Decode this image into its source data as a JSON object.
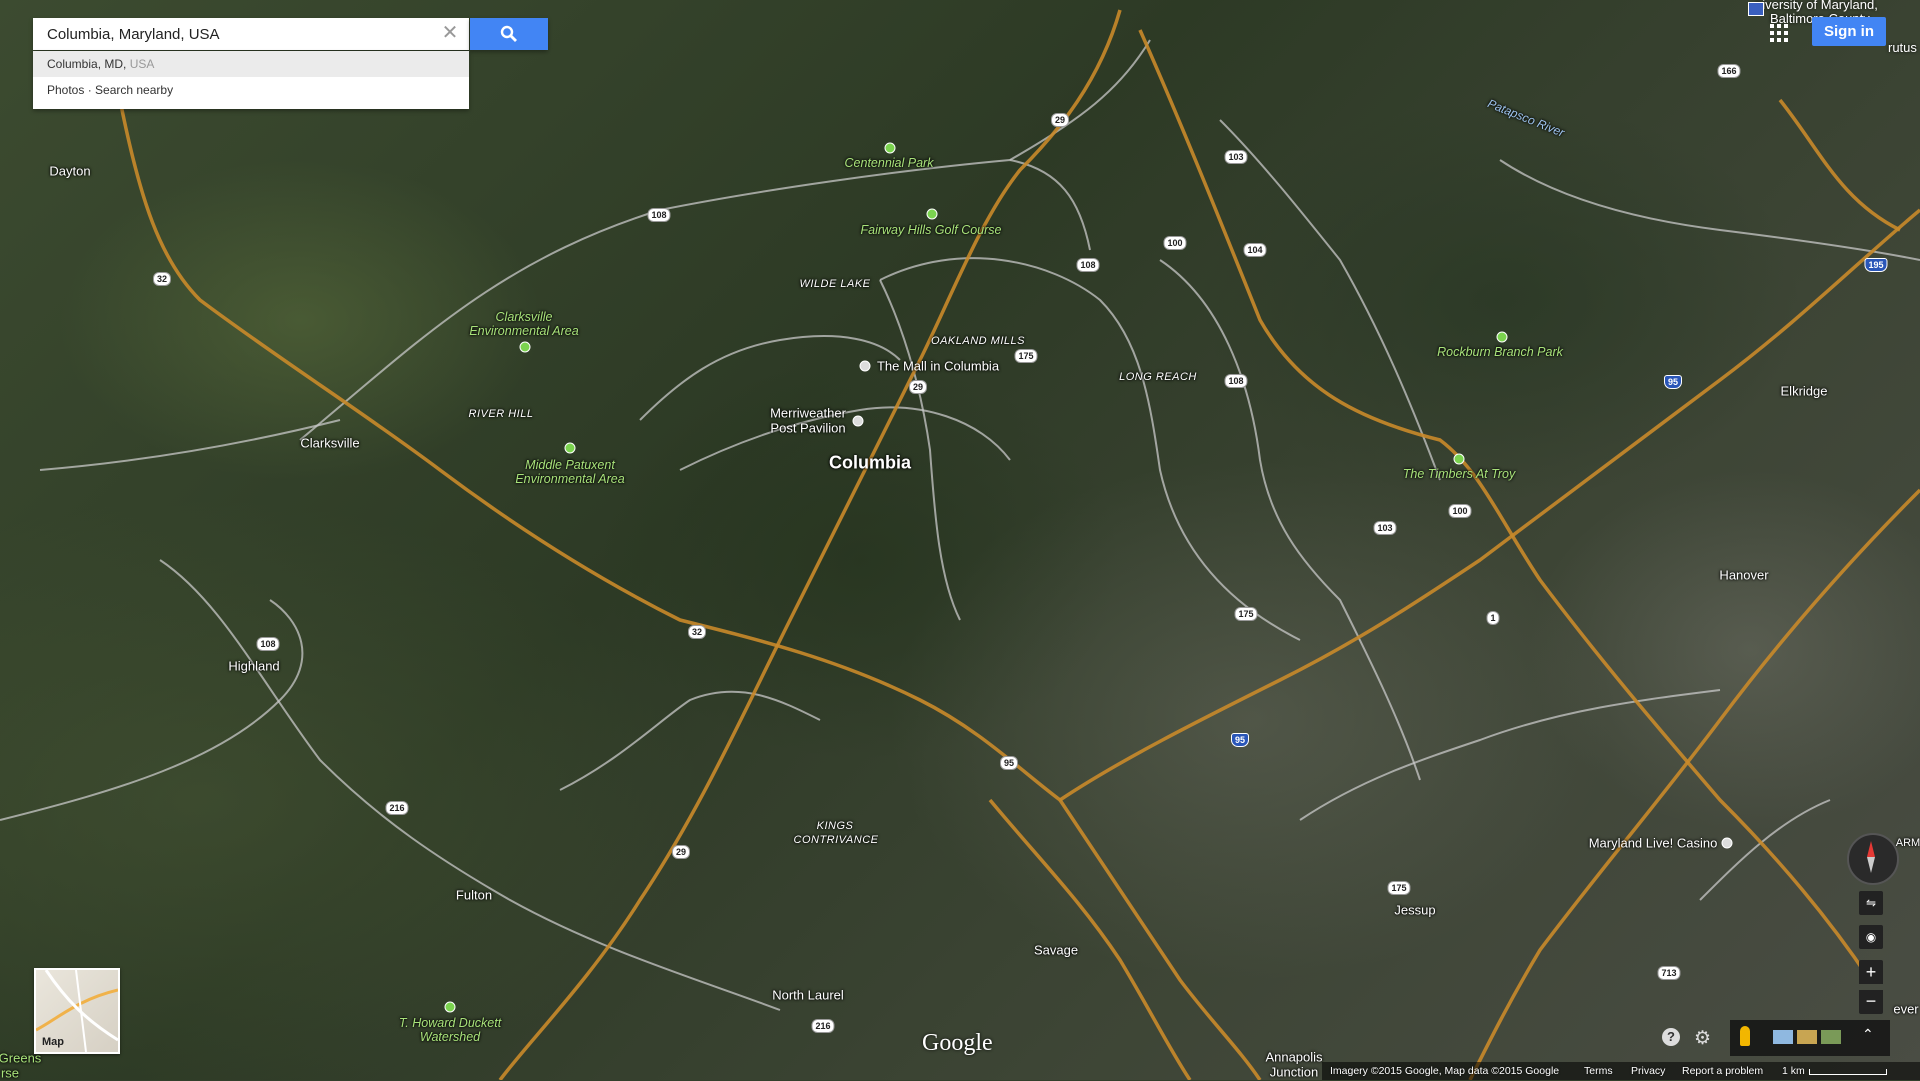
{
  "search": {
    "value": "Columbia, Maryland, USA",
    "suggestion_primary": "Columbia, MD,",
    "suggestion_secondary": "USA",
    "actions": "Photos · Search nearby"
  },
  "header": {
    "sign_in_label": "Sign in",
    "corner_text_1": "niversity of Maryland,",
    "corner_text_2": "Baltimore County",
    "corner_text_3": "rutus"
  },
  "labels": {
    "columbia": "Columbia",
    "dayton": "Dayton",
    "clarksville": "Clarksville",
    "highland": "Highland",
    "fulton": "Fulton",
    "north_laurel": "North Laurel",
    "savage": "Savage",
    "jessup": "Jessup",
    "elkridge": "Elkridge",
    "hanover": "Hanover",
    "annapolis_junction_1": "Annapolis",
    "annapolis_junction_2": "Junction",
    "greens": "Greens",
    "rse": "rse",
    "arm": "ARM",
    "ever": "ever",
    "wilde_lake": "WILDE LAKE",
    "oakland_mills": "OAKLAND MILLS",
    "long_reach": "LONG REACH",
    "river_hill": "RIVER HILL",
    "kings_contrivance_1": "KINGS",
    "kings_contrivance_2": "CONTRIVANCE",
    "centennial_park": "Centennial Park",
    "fairway_hills": "Fairway Hills Golf Course",
    "clarksville_env": "Clarksville Environmental Area",
    "middle_patuxent": "Middle Patuxent Environmental Area",
    "rockburn": "Rockburn Branch Park",
    "timbers": "The Timbers At Troy",
    "t_howard": "T. Howard Duckett Watershed",
    "mall": "The Mall in Columbia",
    "merriweather_1": "Merriweather",
    "merriweather_2": "Post Pavilion",
    "maryland_live": "Maryland Live! Casino",
    "patapsco": "Patapsco River"
  },
  "shields": [
    "108",
    "32",
    "29",
    "103",
    "100",
    "104",
    "108",
    "175",
    "29",
    "108",
    "175",
    "103",
    "100",
    "1",
    "95",
    "32",
    "29",
    "216",
    "108",
    "216",
    "175",
    "713",
    "95",
    "166",
    "195",
    "95"
  ],
  "minimap": {
    "label": "Map"
  },
  "footer": {
    "imagery": "Imagery ©2015 Google, Map data ©2015 Google",
    "terms": "Terms",
    "privacy": "Privacy",
    "report": "Report a problem",
    "scale": "1 km"
  },
  "brand": {
    "logo": "Google"
  },
  "colors": {
    "accent": "#4285f4",
    "park": "#a8e27a",
    "highway": "#c98a2a",
    "road": "#d8d8d8"
  }
}
